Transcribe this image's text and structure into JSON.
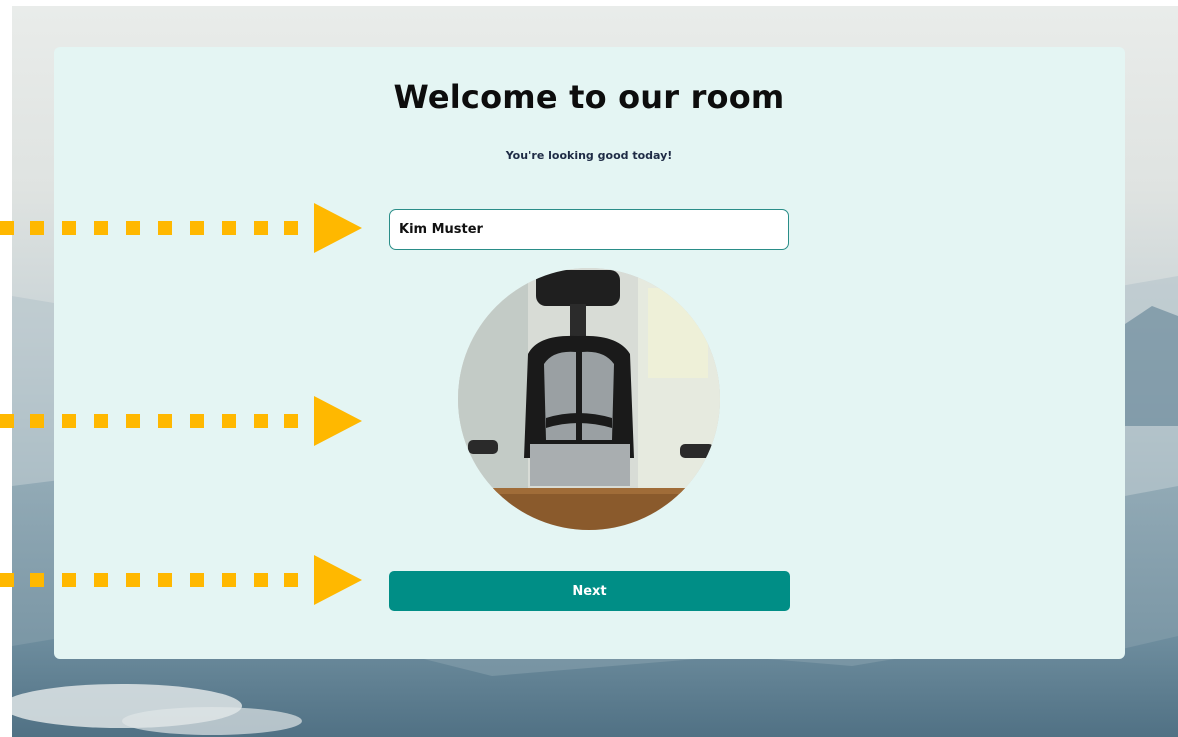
{
  "heading": {
    "title": "Welcome to our room",
    "subtitle": "You're looking good today!"
  },
  "form": {
    "name_value": "Kim Muster"
  },
  "actions": {
    "next_label": "Next"
  },
  "colors": {
    "card_background": "#e4f5f3",
    "accent": "#008e86",
    "input_border": "#2a8d88",
    "annotation_arrow": "#ffb800"
  },
  "icons": {
    "annotation_pointer": "arrow-right-icon",
    "camera_preview": "camera-preview"
  }
}
